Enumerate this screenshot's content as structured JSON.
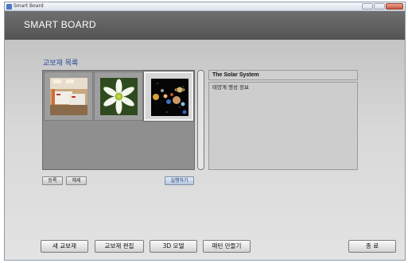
{
  "window": {
    "title": "Smart Board"
  },
  "header": {
    "title": "SMART BOARD"
  },
  "library": {
    "title": "교보재 목록",
    "items": [
      {
        "name": "office-photo"
      },
      {
        "name": "flower-photo"
      },
      {
        "name": "solar-system-photo"
      }
    ],
    "selected_index": 2
  },
  "detail": {
    "title": "The Solar System",
    "description": "태양계 행성 정보"
  },
  "actions": {
    "register": "등록",
    "remove": "해제",
    "run": "실행하기"
  },
  "bottom": {
    "new_material": "새 교보재",
    "edit_material": "교보재 편집",
    "model_3d": "3D 모델",
    "make_pattern": "패턴 만들기",
    "exit": "종 료"
  },
  "colors": {
    "header_bg": "#5f5f5f",
    "section_title": "#2a4c9c",
    "content_bg": "#d8d8d8"
  }
}
